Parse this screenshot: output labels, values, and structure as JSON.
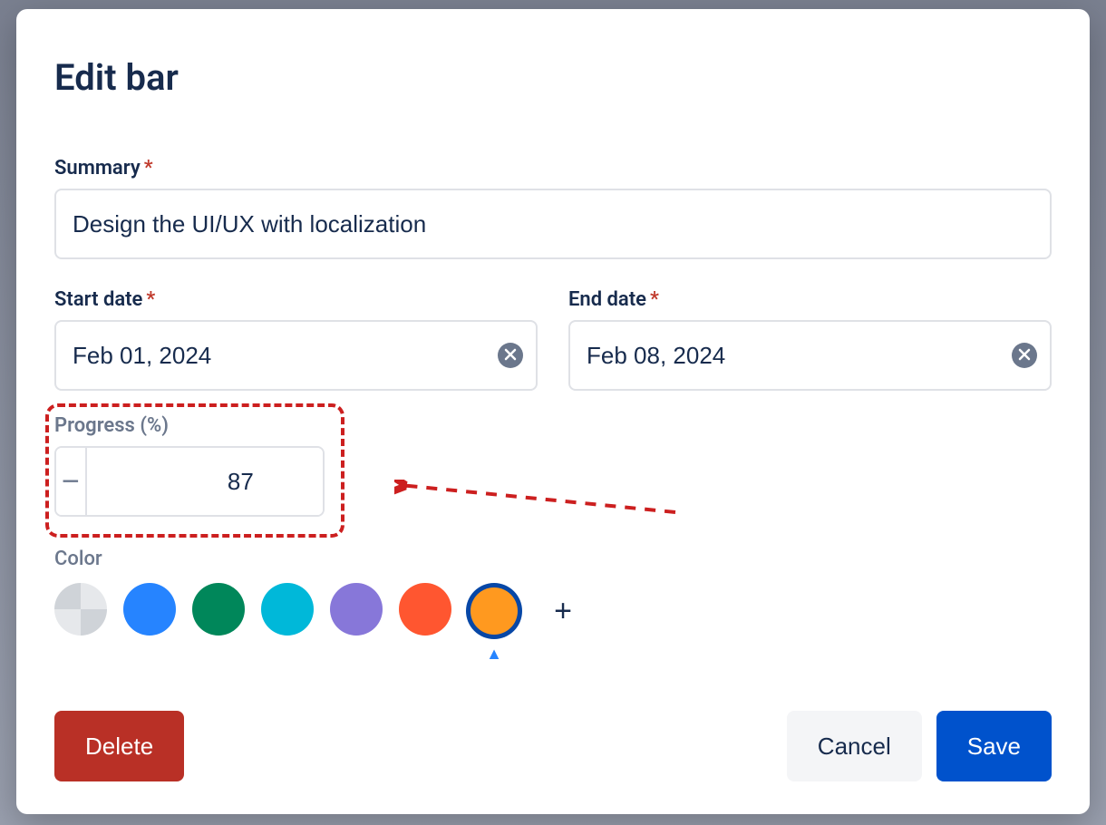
{
  "dialog": {
    "title": "Edit bar",
    "summary": {
      "label": "Summary",
      "value": "Design the UI/UX with localization"
    },
    "start_date": {
      "label": "Start date",
      "value": "Feb 01, 2024"
    },
    "end_date": {
      "label": "End date",
      "value": "Feb 08, 2024"
    },
    "progress": {
      "label": "Progress (%)",
      "value": "87"
    },
    "color": {
      "label": "Color",
      "options": [
        {
          "name": "none",
          "hex": ""
        },
        {
          "name": "blue",
          "hex": "#2684ff"
        },
        {
          "name": "green",
          "hex": "#00875a"
        },
        {
          "name": "teal",
          "hex": "#00b8d9"
        },
        {
          "name": "purple",
          "hex": "#8777d9"
        },
        {
          "name": "red",
          "hex": "#ff5630"
        },
        {
          "name": "orange",
          "hex": "#ff991f"
        }
      ],
      "selected_index": 6
    },
    "buttons": {
      "delete": "Delete",
      "cancel": "Cancel",
      "save": "Save"
    }
  }
}
